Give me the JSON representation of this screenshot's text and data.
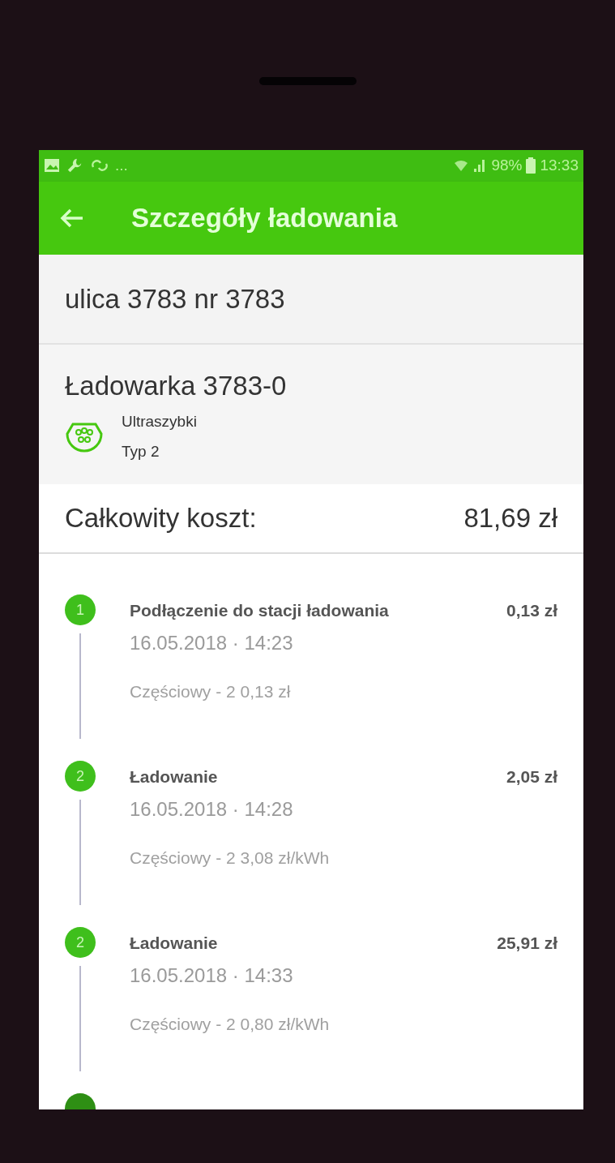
{
  "status_bar": {
    "overflow": "...",
    "battery": "98%",
    "time": "13:33"
  },
  "toolbar": {
    "title": "Szczegóły ładowania"
  },
  "address": "ulica 3783 nr 3783",
  "charger": {
    "name": "Ładowarka 3783-0",
    "speed": "Ultraszybki",
    "type": "Typ 2"
  },
  "total": {
    "label": "Całkowity koszt:",
    "value": "81,69 zł"
  },
  "steps": [
    {
      "number": "1",
      "title": "Podłączenie do stacji ładowania",
      "amount": "0,13 zł",
      "datetime": "16.05.2018 · 14:23",
      "detail": "Częściowy - 2 0,13 zł"
    },
    {
      "number": "2",
      "title": "Ładowanie",
      "amount": "2,05 zł",
      "datetime": "16.05.2018 · 14:28",
      "detail": "Częściowy - 2 3,08 zł/kWh"
    },
    {
      "number": "2",
      "title": "Ładowanie",
      "amount": "25,91 zł",
      "datetime": "16.05.2018 · 14:33",
      "detail": "Częściowy - 2 0,80 zł/kWh"
    }
  ],
  "next_step_partially_visible": true
}
